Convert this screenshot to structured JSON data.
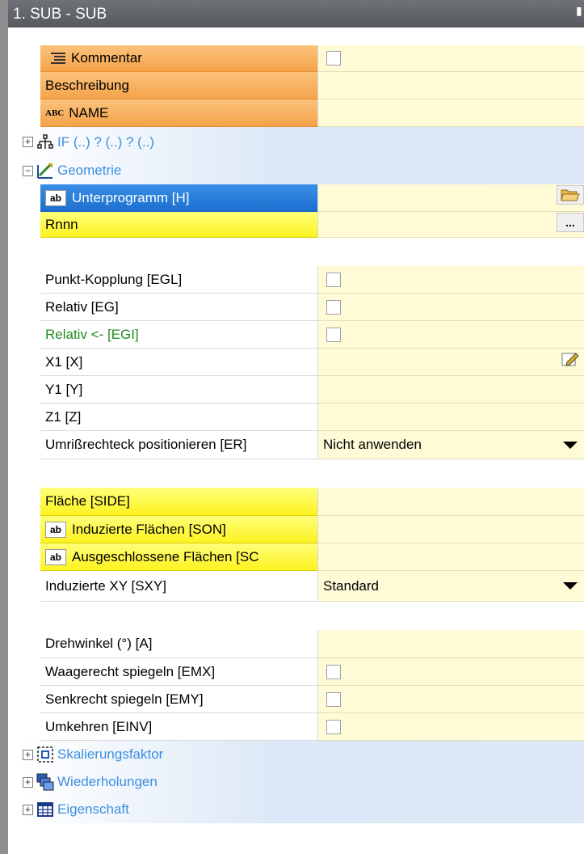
{
  "window": {
    "title": "1. SUB - SUB"
  },
  "rows": {
    "kommentar": {
      "label": "Kommentar",
      "checked": false
    },
    "beschreibung": {
      "label": "Beschreibung",
      "value": ""
    },
    "name": {
      "icon_text": "ABC",
      "label": "NAME",
      "value": ""
    },
    "if_group": {
      "label": "IF (..) ? (..) ? (..)",
      "expander": "+"
    },
    "geometrie_group": {
      "label": "Geometrie",
      "expander": "−"
    },
    "unterprogramm": {
      "icon_text": "ab",
      "label": "Unterprogramm [H]",
      "value": ""
    },
    "rnnn": {
      "label": "Rnnn",
      "button": "..."
    },
    "punkt_kopplung": {
      "label": "Punkt-Kopplung [EGL]",
      "checked": false
    },
    "relativ": {
      "label": "Relativ [EG]",
      "checked": false
    },
    "relativ_egi": {
      "label": "Relativ <- [EGI]",
      "checked": false
    },
    "x1": {
      "label": "X1 [X]",
      "value": ""
    },
    "y1": {
      "label": "Y1 [Y]",
      "value": ""
    },
    "z1": {
      "label": "Z1 [Z]",
      "value": ""
    },
    "umriss": {
      "label": "Umrißrechteck positionieren [ER]",
      "value": "Nicht anwenden"
    },
    "flaeche": {
      "label": "Fläche [SIDE]",
      "value": ""
    },
    "induzierte_flaechen": {
      "icon_text": "ab",
      "label": "Induzierte Flächen [SON]",
      "value": ""
    },
    "ausgeschlossene_flaechen": {
      "icon_text": "ab",
      "label": "Ausgeschlossene Flächen [SC",
      "value": ""
    },
    "induzierte_xy": {
      "label": "Induzierte XY  [SXY]",
      "value": "Standard"
    },
    "drehwinkel": {
      "label": "Drehwinkel (°) [A]",
      "value": ""
    },
    "waagerecht": {
      "label": "Waagerecht spiegeln [EMX]",
      "checked": false
    },
    "senkrecht": {
      "label": "Senkrecht spiegeln [EMY]",
      "checked": false
    },
    "umkehren": {
      "label": "Umkehren [EINV]",
      "checked": false
    },
    "skalierung_group": {
      "label": "Skalierungsfaktor",
      "expander": "+"
    },
    "wiederholungen_group": {
      "label": "Wiederholungen",
      "expander": "+"
    },
    "eigenschaft_group": {
      "label": "Eigenschaft",
      "expander": "+"
    }
  },
  "colors": {
    "accent_orange": "#f5a34a",
    "accent_yellow": "#fdf21f",
    "selection_blue": "#1c6fcf",
    "value_cell": "#fffbd7",
    "group_text": "#3b8fe0",
    "green_text": "#228b22"
  },
  "icons": {
    "pin": "pin-icon",
    "folder": "folder-open-icon",
    "edit": "edit-pencil-icon",
    "list": "list-icon",
    "if": "branch-icon",
    "geometry": "geometry-icon",
    "scale": "scale-icon",
    "repeat": "repeat-icon",
    "properties": "table-icon"
  }
}
